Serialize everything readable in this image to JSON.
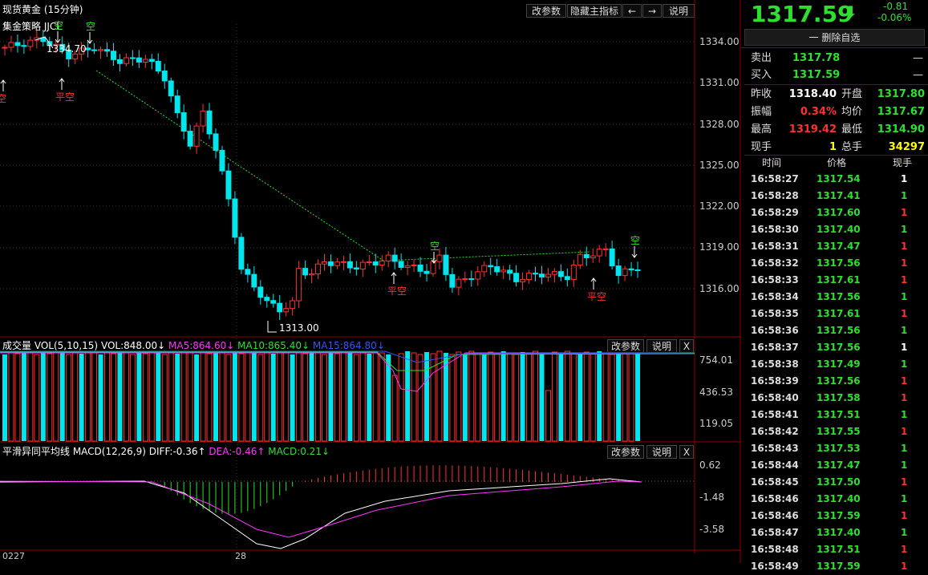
{
  "main_chart": {
    "title": "现货黄金 (15分钟)",
    "strategy": "集金策略 JJCL",
    "buttons": [
      "改参数",
      "隐藏主指标",
      "←",
      "→",
      "说明"
    ],
    "y_ticks": [
      "1334.00",
      "1331.00",
      "1328.00",
      "1325.00",
      "1322.00",
      "1319.00",
      "1316.00"
    ],
    "high_label": "1334.70",
    "low_label": "1313.00",
    "signals": [
      {
        "text": "空",
        "color": "#ff3030",
        "arrow": "up"
      },
      {
        "text": "空",
        "color": "#2ee02e",
        "arrow": "down"
      },
      {
        "text": "平空",
        "color": "#ff3030",
        "arrow": "up"
      },
      {
        "text": "空",
        "color": "#2ee02e",
        "arrow": "down"
      },
      {
        "text": "平空",
        "color": "#ff3030",
        "arrow": "up"
      },
      {
        "text": "空",
        "color": "#2ee02e",
        "arrow": "down"
      },
      {
        "text": "平空",
        "color": "#ff3030",
        "arrow": "up"
      },
      {
        "text": "空",
        "color": "#2ee02e",
        "arrow": "down"
      }
    ]
  },
  "volume_panel": {
    "label": "成交量 VOL(5,10,15)",
    "vol": "VOL:848.00↓",
    "ma5": "MA5:864.60↓",
    "ma10": "MA10:865.40↓",
    "ma15": "MA15:864.80↓",
    "buttons": [
      "改参数",
      "说明",
      "X"
    ],
    "y_ticks": [
      "754.01",
      "436.53",
      "119.05"
    ]
  },
  "macd_panel": {
    "label": "平滑异同平均线 MACD(12,26,9)",
    "diff": "DIFF:-0.36↑",
    "dea": "DEA:-0.46↑",
    "macd": "MACD:0.21↓",
    "buttons": [
      "改参数",
      "说明",
      "X"
    ],
    "y_ticks": [
      "0.62",
      "-1.48",
      "-3.58"
    ]
  },
  "x_axis": {
    "labels": [
      "0227",
      "28"
    ]
  },
  "quote": {
    "price": "1317.59",
    "change": "-0.81",
    "change_pct": "-0.06%",
    "remove_button": "一 删除自选",
    "sell_label": "卖出",
    "sell_price": "1317.78",
    "sell_vol": "—",
    "buy_label": "买入",
    "buy_price": "1317.59",
    "buy_vol": "—",
    "fields": [
      {
        "label": "昨收",
        "value": "1318.40",
        "label2": "开盘",
        "value2": "1317.80",
        "c1": "#ffffff",
        "c2": "#2ee02e"
      },
      {
        "label": "振幅",
        "value": "0.34%",
        "label2": "均价",
        "value2": "1317.67",
        "c1": "#ff3030",
        "c2": "#2ee02e"
      },
      {
        "label": "最高",
        "value": "1319.42",
        "label2": "最低",
        "value2": "1314.90",
        "c1": "#ff3030",
        "c2": "#2ee02e"
      },
      {
        "label": "现手",
        "value": "1",
        "label2": "总手",
        "value2": "34297",
        "c1": "#ffff00",
        "c2": "#ffff00"
      }
    ],
    "tick_headers": [
      "时间",
      "价格",
      "现手"
    ],
    "ticks": [
      {
        "time": "16:58:27",
        "price": "1317.54",
        "vol": "1",
        "vc": "#ffffff"
      },
      {
        "time": "16:58:28",
        "price": "1317.41",
        "vol": "1",
        "vc": "#2ee02e"
      },
      {
        "time": "16:58:29",
        "price": "1317.60",
        "vol": "1",
        "vc": "#ff3030"
      },
      {
        "time": "16:58:30",
        "price": "1317.40",
        "vol": "1",
        "vc": "#2ee02e"
      },
      {
        "time": "16:58:31",
        "price": "1317.47",
        "vol": "1",
        "vc": "#ff3030"
      },
      {
        "time": "16:58:32",
        "price": "1317.56",
        "vol": "1",
        "vc": "#ff3030"
      },
      {
        "time": "16:58:33",
        "price": "1317.61",
        "vol": "1",
        "vc": "#ff3030"
      },
      {
        "time": "16:58:34",
        "price": "1317.56",
        "vol": "1",
        "vc": "#2ee02e"
      },
      {
        "time": "16:58:35",
        "price": "1317.61",
        "vol": "1",
        "vc": "#ff3030"
      },
      {
        "time": "16:58:36",
        "price": "1317.56",
        "vol": "1",
        "vc": "#2ee02e"
      },
      {
        "time": "16:58:37",
        "price": "1317.56",
        "vol": "1",
        "vc": "#ffffff"
      },
      {
        "time": "16:58:38",
        "price": "1317.49",
        "vol": "1",
        "vc": "#2ee02e"
      },
      {
        "time": "16:58:39",
        "price": "1317.56",
        "vol": "1",
        "vc": "#ff3030"
      },
      {
        "time": "16:58:40",
        "price": "1317.58",
        "vol": "1",
        "vc": "#ff3030"
      },
      {
        "time": "16:58:41",
        "price": "1317.51",
        "vol": "1",
        "vc": "#2ee02e"
      },
      {
        "time": "16:58:42",
        "price": "1317.55",
        "vol": "1",
        "vc": "#ff3030"
      },
      {
        "time": "16:58:43",
        "price": "1317.53",
        "vol": "1",
        "vc": "#2ee02e"
      },
      {
        "time": "16:58:44",
        "price": "1317.47",
        "vol": "1",
        "vc": "#2ee02e"
      },
      {
        "time": "16:58:45",
        "price": "1317.50",
        "vol": "1",
        "vc": "#ff3030"
      },
      {
        "time": "16:58:46",
        "price": "1317.40",
        "vol": "1",
        "vc": "#2ee02e"
      },
      {
        "time": "16:58:46",
        "price": "1317.59",
        "vol": "1",
        "vc": "#ff3030"
      },
      {
        "time": "16:58:47",
        "price": "1317.40",
        "vol": "1",
        "vc": "#2ee02e"
      },
      {
        "time": "16:58:48",
        "price": "1317.51",
        "vol": "1",
        "vc": "#ff3030"
      },
      {
        "time": "16:58:49",
        "price": "1317.59",
        "vol": "1",
        "vc": "#ff3030"
      }
    ]
  },
  "colors": {
    "up": "#ff3030",
    "down": "#00e5ee",
    "green": "#2ee02e",
    "yellow": "#ffff00",
    "magenta": "#ff33ff",
    "blue": "#3355ff"
  }
}
